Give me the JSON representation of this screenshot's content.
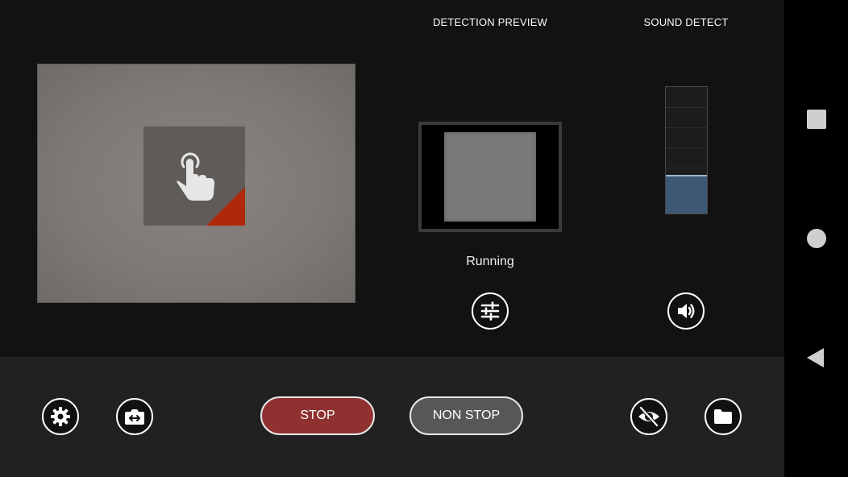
{
  "preview": {
    "detection_title": "DETECTION PREVIEW",
    "sound_title": "SOUND DETECT",
    "status": "Running"
  },
  "sound_meter": {
    "level_fraction": 0.29
  },
  "controls": {
    "stop_label": "STOP",
    "non_stop_label": "NON STOP"
  },
  "colors": {
    "stop_button": "#8f3131",
    "non_stop_button": "#575757",
    "touch_corner": "#b0280b",
    "meter_fill": "#3d5873"
  },
  "icons": {
    "touch": "pointing-hand-icon",
    "filter": "sliders-icon",
    "sound": "speaker-icon",
    "settings": "gear-icon",
    "switch_camera": "switch-camera-icon",
    "hide": "eye-off-icon",
    "folder": "folder-icon"
  }
}
